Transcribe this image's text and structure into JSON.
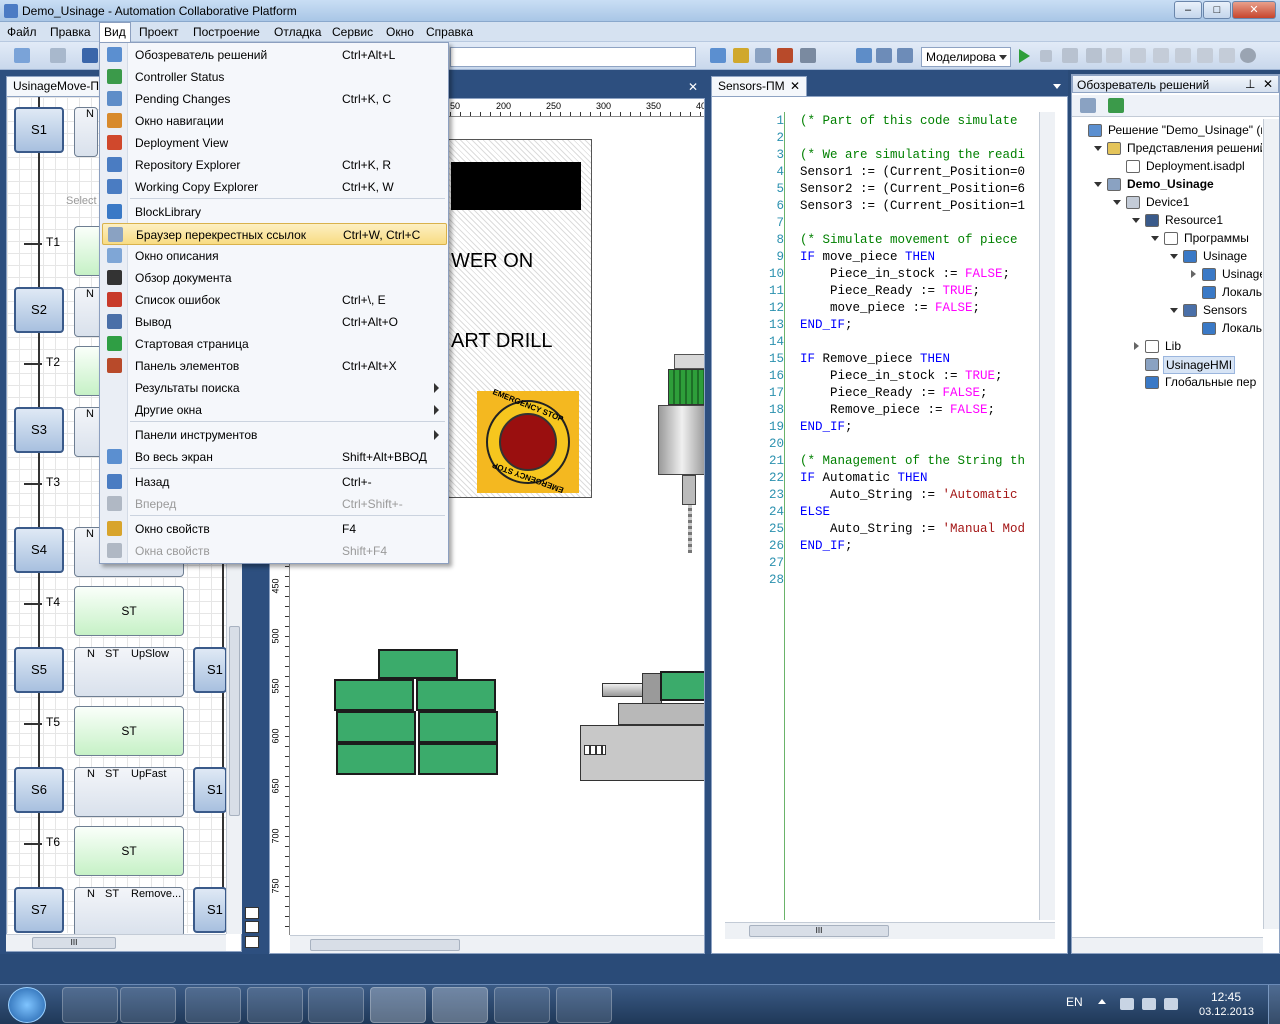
{
  "window": {
    "title": "Demo_Usinage - Automation Collaborative Platform",
    "min": "–",
    "max": "□",
    "close": "✕"
  },
  "menubar": [
    "Файл",
    "Правка",
    "Вид",
    "Проект",
    "Построение",
    "Отладка",
    "Сервис",
    "Окно",
    "Справка"
  ],
  "toolbar": {
    "sim_mode": "Моделирова"
  },
  "tabs": {
    "left": "UsinageMove-П",
    "editor": "Sensors-ПМ",
    "solution": "Обозреватель решений"
  },
  "view_menu": [
    {
      "label": "Обозреватель решений",
      "shortcut": "Ctrl+Alt+L",
      "icon": "solution-explorer-icon",
      "color": "#5b8fd0"
    },
    {
      "label": "Controller Status",
      "shortcut": "",
      "icon": "controller-status-icon",
      "color": "#3b9a4a"
    },
    {
      "label": "Pending Changes",
      "shortcut": "Ctrl+K, C",
      "icon": "pending-changes-icon",
      "color": "#5e8dc8"
    },
    {
      "label": "Окно навигации",
      "shortcut": "",
      "icon": "navigation-window-icon",
      "color": "#d88a2c"
    },
    {
      "label": "Deployment View",
      "shortcut": "",
      "icon": "deployment-view-icon",
      "color": "#d0482c"
    },
    {
      "label": "Repository Explorer",
      "shortcut": "Ctrl+K, R",
      "icon": "repository-explorer-icon",
      "color": "#4a7cc2"
    },
    {
      "label": "Working Copy Explorer",
      "shortcut": "Ctrl+K, W",
      "icon": "working-copy-icon",
      "color": "#4a7cc2"
    },
    {
      "label": "BlockLibrary",
      "shortcut": "",
      "icon": "block-library-icon",
      "color": "#3a79c6"
    },
    {
      "label": "Браузер перекрестных ссылок",
      "shortcut": "Ctrl+W, Ctrl+C",
      "icon": "magnifier-icon",
      "color": "#8aa2c2"
    },
    {
      "label": "Окно описания",
      "shortcut": "",
      "icon": "description-window-icon",
      "color": "#7fa6d6"
    },
    {
      "label": "Обзор документа",
      "shortcut": "",
      "icon": "document-outline-icon",
      "color": "#333333"
    },
    {
      "label": "Список ошибок",
      "shortcut": "Ctrl+\\, E",
      "icon": "error-list-icon",
      "color": "#c83a2a"
    },
    {
      "label": "Вывод",
      "shortcut": "Ctrl+Alt+O",
      "icon": "output-icon",
      "color": "#4a6fa8"
    },
    {
      "label": "Стартовая страница",
      "shortcut": "",
      "icon": "start-page-icon",
      "color": "#2f9e44"
    },
    {
      "label": "Панель элементов",
      "shortcut": "Ctrl+Alt+X",
      "icon": "toolbox-icon",
      "color": "#b84a2a"
    },
    {
      "label": "Результаты поиска",
      "shortcut": "",
      "icon": "",
      "color": ""
    },
    {
      "label": "Другие окна",
      "shortcut": "",
      "icon": "",
      "color": ""
    },
    {
      "label": "Панели инструментов",
      "shortcut": "",
      "icon": "",
      "color": ""
    },
    {
      "label": "Во весь экран",
      "shortcut": "Shift+Alt+ВВОД",
      "icon": "full-screen-icon",
      "color": "#5b8fd0"
    },
    {
      "label": "Назад",
      "shortcut": "Ctrl+-",
      "icon": "back-icon",
      "color": "#4a7cc2"
    },
    {
      "label": "Вперед",
      "shortcut": "Ctrl+Shift+-",
      "icon": "forward-icon",
      "color": "#b0b8c4"
    },
    {
      "label": "Окно свойств",
      "shortcut": "F4",
      "icon": "properties-window-icon",
      "color": "#d8a42c"
    },
    {
      "label": "Окна свойств",
      "shortcut": "Shift+F4",
      "icon": "property-pages-icon",
      "color": "#b0b8c4"
    }
  ],
  "sfc": {
    "steps": [
      "S1",
      "S2",
      "S3",
      "S4",
      "S5",
      "S6",
      "S7"
    ],
    "transitions": [
      "T1",
      "T2",
      "T3",
      "T4",
      "T5",
      "T6"
    ],
    "select_hint": "Select",
    "actions": [
      {
        "text": "ST"
      },
      {
        "text": "ST"
      },
      {
        "text": "ST"
      },
      {
        "q": "N",
        "st": "ST",
        "name": "UpSlow"
      },
      {
        "q": "N",
        "st": "ST",
        "name": "UpFast"
      },
      {
        "q": "N",
        "st": "ST",
        "name": "Remove..."
      }
    ],
    "right_steps": [
      "S1",
      "S1",
      "S1"
    ],
    "n_label": "N",
    "scroll": "III"
  },
  "hmi": {
    "ruler_top": [
      "50",
      "200",
      "250",
      "300",
      "350",
      "40"
    ],
    "ruler_left": [
      "450",
      "500",
      "550",
      "600",
      "650",
      "700",
      "750"
    ],
    "power_text": "WER ON",
    "drill_text": "ART DRILL",
    "estop_top": "EMERGENCY STOP",
    "estop_bottom": "EMERGENCY STOP"
  },
  "code": {
    "line_numbers": [
      "1",
      "2",
      "3",
      "4",
      "5",
      "6",
      "7",
      "8",
      "9",
      "10",
      "11",
      "12",
      "13",
      "14",
      "15",
      "16",
      "17",
      "18",
      "19",
      "20",
      "21",
      "22",
      "23",
      "24",
      "25",
      "26",
      "27",
      "28"
    ],
    "lines": [
      [
        [
          "cm",
          "(* Part of this code simulate"
        ]
      ],
      [],
      [
        [
          "cm",
          "(* We are simulating the readi"
        ]
      ],
      [
        [
          "",
          "Sensor1 := (Current_Position=0"
        ]
      ],
      [
        [
          "",
          "Sensor2 := (Current_Position=6"
        ]
      ],
      [
        [
          "",
          "Sensor3 := (Current_Position=1"
        ]
      ],
      [],
      [
        [
          "cm",
          "(* Simulate movement of piece"
        ]
      ],
      [
        [
          "kw",
          "IF"
        ],
        [
          "",
          " move_piece "
        ],
        [
          "kw",
          "THEN"
        ]
      ],
      [
        [
          "",
          "    Piece_in_stock := "
        ],
        [
          "bl",
          "FALSE"
        ],
        [
          "",
          ";"
        ]
      ],
      [
        [
          "",
          "    Piece_Ready := "
        ],
        [
          "bl",
          "TRUE"
        ],
        [
          "",
          ";"
        ]
      ],
      [
        [
          "",
          "    move_piece := "
        ],
        [
          "bl",
          "FALSE"
        ],
        [
          "",
          ";"
        ]
      ],
      [
        [
          "kw",
          "END_IF"
        ],
        [
          "",
          ";"
        ]
      ],
      [],
      [
        [
          "kw",
          "IF"
        ],
        [
          "",
          " Remove_piece "
        ],
        [
          "kw",
          "THEN"
        ]
      ],
      [
        [
          "",
          "    Piece_in_stock := "
        ],
        [
          "bl",
          "TRUE"
        ],
        [
          "",
          ";"
        ]
      ],
      [
        [
          "",
          "    Piece_Ready := "
        ],
        [
          "bl",
          "FALSE"
        ],
        [
          "",
          ";"
        ]
      ],
      [
        [
          "",
          "    Remove_piece := "
        ],
        [
          "bl",
          "FALSE"
        ],
        [
          "",
          ";"
        ]
      ],
      [
        [
          "kw",
          "END_IF"
        ],
        [
          "",
          ";"
        ]
      ],
      [],
      [
        [
          "cm",
          "(* Management of the String th"
        ]
      ],
      [
        [
          "kw",
          "IF"
        ],
        [
          "",
          " Automatic "
        ],
        [
          "kw",
          "THEN"
        ]
      ],
      [
        [
          "",
          "    Auto_String := "
        ],
        [
          "str",
          "'Automatic"
        ]
      ],
      [
        [
          "kw",
          "ELSE"
        ]
      ],
      [
        [
          "",
          "    Auto_String := "
        ],
        [
          "str",
          "'Manual Mod"
        ]
      ],
      [
        [
          "kw",
          "END_IF"
        ],
        [
          "",
          ";"
        ]
      ],
      [],
      []
    ],
    "scroll": "III"
  },
  "solution_tree": [
    {
      "label": "Решение \"Demo_Usinage\"  (пр",
      "indent": 0,
      "icon": "solution-icon",
      "bold": false,
      "exp": ""
    },
    {
      "label": "Представления решений",
      "indent": 1,
      "icon": "folder-icon",
      "bold": false,
      "exp": "open"
    },
    {
      "label": "Deployment.isadpl",
      "indent": 2,
      "icon": "file-icon",
      "bold": false,
      "exp": ""
    },
    {
      "label": "Demo_Usinage",
      "indent": 1,
      "icon": "project-icon",
      "bold": true,
      "exp": "open"
    },
    {
      "label": "Device1",
      "indent": 2,
      "icon": "device-icon",
      "bold": false,
      "exp": "open"
    },
    {
      "label": "Resource1",
      "indent": 3,
      "icon": "resource-icon",
      "bold": false,
      "exp": "open"
    },
    {
      "label": "Программы",
      "indent": 4,
      "icon": "programs-icon",
      "bold": false,
      "exp": "open"
    },
    {
      "label": "Usinage",
      "indent": 5,
      "icon": "sfc-program-icon",
      "bold": false,
      "exp": "open"
    },
    {
      "label": "UsinageM",
      "indent": 6,
      "icon": "sfc-program-icon",
      "bold": false,
      "exp": "closed"
    },
    {
      "label": "Локальнь",
      "indent": 6,
      "icon": "variables-icon",
      "bold": false,
      "exp": ""
    },
    {
      "label": "Sensors",
      "indent": 5,
      "icon": "st-program-icon",
      "bold": false,
      "exp": "open"
    },
    {
      "label": "Локальнь",
      "indent": 6,
      "icon": "variables-icon",
      "bold": false,
      "exp": ""
    },
    {
      "label": "Lib",
      "indent": 3,
      "icon": "library-icon",
      "bold": false,
      "exp": "closed"
    },
    {
      "label": "UsinageHMI",
      "indent": 3,
      "icon": "hmi-icon",
      "bold": false,
      "exp": "",
      "sel": true
    },
    {
      "label": "Глобальные пер",
      "indent": 3,
      "icon": "variables-icon",
      "bold": false,
      "exp": ""
    }
  ],
  "taskbar": {
    "lang": "EN",
    "time": "12:45",
    "date": "03.12.2013"
  }
}
